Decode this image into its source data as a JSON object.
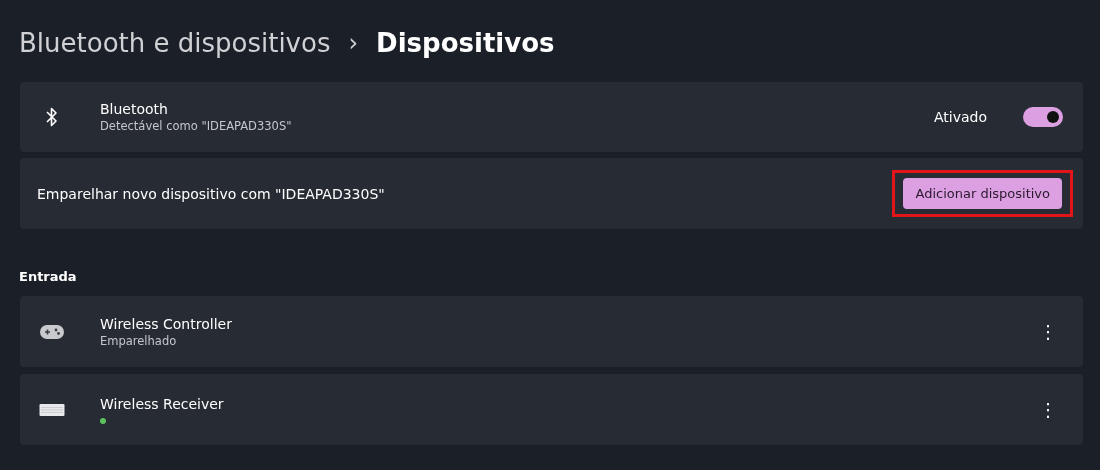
{
  "breadcrumb": {
    "parent": "Bluetooth e dispositivos",
    "separator": "›",
    "current": "Dispositivos"
  },
  "bluetooth": {
    "title": "Bluetooth",
    "subtitle": "Detectável como \"IDEAPAD330S\"",
    "state_label": "Ativado",
    "on": true
  },
  "pair": {
    "text": "Emparelhar novo dispositivo com \"IDEAPAD330S\"",
    "button": "Adicionar dispositivo",
    "highlighted": true
  },
  "section": "Entrada",
  "devices": [
    {
      "kind": "gamepad",
      "name": "Wireless Controller",
      "subtitle": "Emparelhado",
      "more_icon": "⋮"
    },
    {
      "kind": "keyboard",
      "name": "Wireless Receiver",
      "status_dot": true,
      "more_icon": "⋮"
    }
  ]
}
